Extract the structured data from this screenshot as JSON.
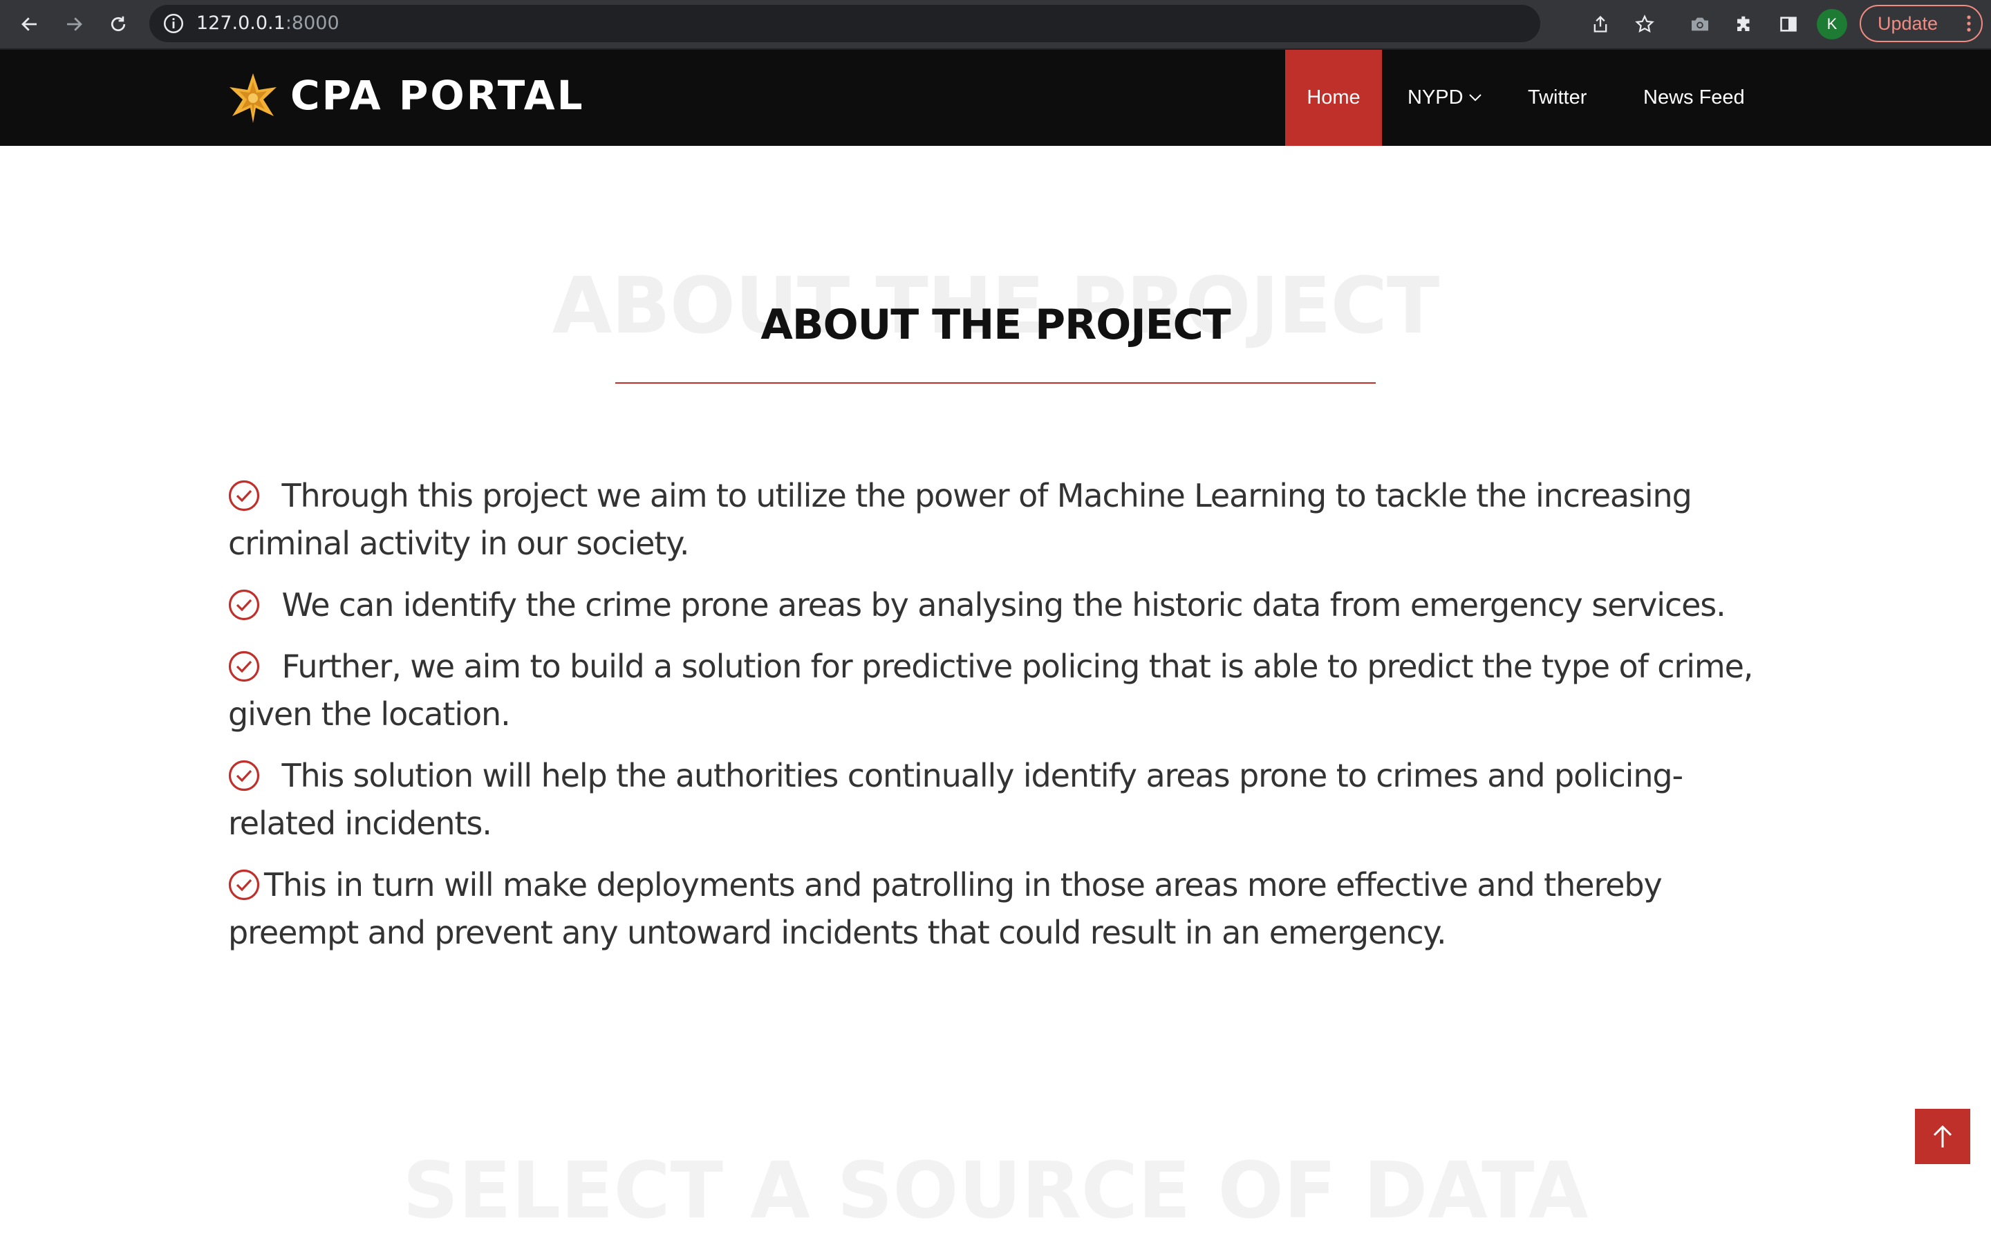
{
  "browser": {
    "url_host": "127.0.0.1",
    "url_port": ":8000",
    "profile_initial": "K",
    "update_label": "Update",
    "icons": [
      "back-icon",
      "forward-icon",
      "reload-icon",
      "info-icon",
      "share-icon",
      "star-icon",
      "camera-icon",
      "extensions-icon",
      "side-panel-icon",
      "kebab-menu-icon"
    ]
  },
  "header": {
    "logo_text": "CPA PORTAL",
    "logo_icon": "star-badge-icon",
    "nav": {
      "home": "Home",
      "nypd": "NYPD",
      "twitter": "Twitter",
      "news_feed": "News Feed"
    },
    "active_nav": "Home"
  },
  "about": {
    "ghost_title": "ABOUT THE PROJECT",
    "title": "ABOUT THE PROJECT",
    "bullets": [
      " Through this project we aim to utilize the power of Machine Learning to tackle the increasing criminal activity in our society.",
      " We can identify the crime prone areas by analysing the historic data from emergency services.",
      " Further, we aim to build a solution for predictive policing that is able to predict the type of crime, given the location.",
      " This solution will help the authorities continually identify areas prone to crimes and policing-related incidents.",
      "This in turn will make deployments and patrolling in those areas more effective and thereby preempt and prevent any untoward incidents that could result in an emergency."
    ]
  },
  "next_section": {
    "ghost_title": "SELECT A SOURCE OF DATA"
  },
  "colors": {
    "accent": "#c0302b",
    "header_bg": "#0d0d0d",
    "text": "#333333"
  }
}
